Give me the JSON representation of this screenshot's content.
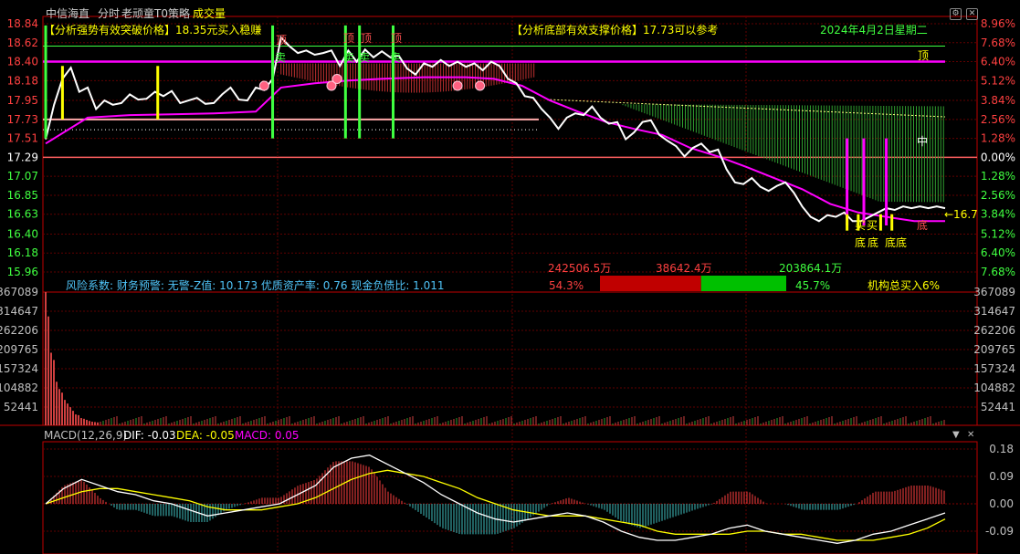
{
  "header": {
    "stock_name": "中信海直",
    "view_mode": "分时",
    "strategy_name": "老顽童T0策略",
    "indicator_name": "成交量",
    "break_price_label": "【分析强势有效突破价格】",
    "break_price_text": "18.35元买入稳赚",
    "support_price_label": "【分析底部有效支撑价格】",
    "support_price_text": "17.73可以参考",
    "date_text": "2024年4月2日星期二"
  },
  "colors": {
    "background": "#000000",
    "frame": "#c00000",
    "price_up": "#ff4040",
    "price_down": "#40ff40",
    "flat": "#ffffff",
    "price_line": "#ffffff",
    "avg_line": "#ff00ff",
    "band_line": "#cc00cc",
    "pink_line": "#ffaaaa",
    "volume_bar": "#d04040",
    "dif": "#ffffff",
    "dea": "#ffff00",
    "macd_label": "#ff00ff"
  },
  "price_axis": {
    "left": [
      "18.84",
      "18.62",
      "18.40",
      "18.18",
      "17.95",
      "17.73",
      "17.51",
      "17.29",
      "17.07",
      "16.85",
      "16.63",
      "16.40",
      "16.18",
      "15.96"
    ],
    "right": [
      "8.96%",
      "7.68%",
      "6.40%",
      "5.12%",
      "3.84%",
      "2.56%",
      "1.28%",
      "0.00%",
      "1.28%",
      "2.56%",
      "3.84%",
      "5.12%",
      "6.40%",
      "7.68%"
    ]
  },
  "volume_axis": {
    "left": [
      "367089",
      "314647",
      "262206",
      "209765",
      "157324",
      "104882",
      "52441"
    ],
    "right": [
      "367089",
      "314647",
      "262206",
      "209765",
      "157324",
      "104882",
      "52441"
    ]
  },
  "macd_axis": [
    "0.18",
    "0.09",
    "0.00",
    "-0.09"
  ],
  "signals": {
    "top": "顶",
    "sell": "卖",
    "buy": "买",
    "bottom": "底",
    "middle": "中",
    "current_price_tag": "←16.7"
  },
  "fund_flow": {
    "buy_amount": "242506.5万",
    "net_amount": "38642.4万",
    "sell_amount": "203864.1万",
    "buy_pct": "54.3%",
    "sell_pct": "45.7%",
    "institution_text": "机构总买入6%",
    "buy_ratio": 0.543
  },
  "fundamentals": {
    "text": "风险系数: 财务预警: 无警-Z值: 10.173 优质资产率: 0.76 现金负债比: 1.011"
  },
  "macd": {
    "title": "MACD(12,26,9)",
    "dif": "DIF: -0.03",
    "dea": "DEA: -0.05",
    "macd": "MACD: 0.05"
  },
  "chart_data": {
    "type": "line",
    "title": "中信海直 分时",
    "reference_price": 17.29,
    "price_range": [
      15.96,
      18.84
    ],
    "break_price": 18.35,
    "support_price": 17.73,
    "upper_limit_line": 18.4,
    "prev_band_line": 17.8,
    "price_points": [
      [
        0,
        17.5
      ],
      [
        3,
        17.9
      ],
      [
        6,
        18.2
      ],
      [
        9,
        18.33
      ],
      [
        12,
        18.05
      ],
      [
        15,
        18.1
      ],
      [
        18,
        17.85
      ],
      [
        21,
        17.95
      ],
      [
        24,
        17.9
      ],
      [
        27,
        17.92
      ],
      [
        30,
        18.02
      ],
      [
        33,
        17.96
      ],
      [
        36,
        17.97
      ],
      [
        39,
        18.05
      ],
      [
        42,
        18.0
      ],
      [
        45,
        18.06
      ],
      [
        48,
        17.92
      ],
      [
        51,
        17.95
      ],
      [
        54,
        17.98
      ],
      [
        57,
        17.91
      ],
      [
        60,
        17.92
      ],
      [
        63,
        18.02
      ],
      [
        66,
        18.1
      ],
      [
        69,
        17.96
      ],
      [
        72,
        17.95
      ],
      [
        75,
        18.1
      ],
      [
        78,
        18.07
      ],
      [
        81,
        18.2
      ],
      [
        84,
        18.68
      ],
      [
        87,
        18.58
      ],
      [
        90,
        18.5
      ],
      [
        93,
        18.53
      ],
      [
        96,
        18.48
      ],
      [
        99,
        18.5
      ],
      [
        102,
        18.53
      ],
      [
        105,
        18.35
      ],
      [
        108,
        18.53
      ],
      [
        111,
        18.4
      ],
      [
        114,
        18.54
      ],
      [
        117,
        18.45
      ],
      [
        120,
        18.52
      ],
      [
        123,
        18.45
      ],
      [
        126,
        18.47
      ],
      [
        129,
        18.32
      ],
      [
        132,
        18.25
      ],
      [
        135,
        18.38
      ],
      [
        138,
        18.34
      ],
      [
        141,
        18.42
      ],
      [
        144,
        18.35
      ],
      [
        147,
        18.4
      ],
      [
        150,
        18.34
      ],
      [
        153,
        18.38
      ],
      [
        156,
        18.3
      ],
      [
        159,
        18.4
      ],
      [
        162,
        18.35
      ],
      [
        165,
        18.2
      ],
      [
        168,
        18.15
      ],
      [
        171,
        18.0
      ],
      [
        174,
        17.98
      ],
      [
        177,
        17.85
      ],
      [
        180,
        17.75
      ],
      [
        183,
        17.62
      ],
      [
        186,
        17.75
      ],
      [
        189,
        17.8
      ],
      [
        192,
        17.78
      ],
      [
        195,
        17.88
      ],
      [
        198,
        17.75
      ],
      [
        201,
        17.68
      ],
      [
        204,
        17.7
      ],
      [
        207,
        17.5
      ],
      [
        210,
        17.58
      ],
      [
        213,
        17.7
      ],
      [
        216,
        17.72
      ],
      [
        219,
        17.55
      ],
      [
        222,
        17.48
      ],
      [
        225,
        17.42
      ],
      [
        228,
        17.3
      ],
      [
        231,
        17.4
      ],
      [
        234,
        17.45
      ],
      [
        237,
        17.35
      ],
      [
        240,
        17.38
      ],
      [
        243,
        17.15
      ],
      [
        246,
        17.0
      ],
      [
        249,
        16.98
      ],
      [
        252,
        17.05
      ],
      [
        255,
        16.95
      ],
      [
        258,
        16.9
      ],
      [
        261,
        16.96
      ],
      [
        264,
        17.0
      ],
      [
        267,
        16.88
      ],
      [
        270,
        16.72
      ],
      [
        273,
        16.6
      ],
      [
        276,
        16.55
      ],
      [
        279,
        16.62
      ],
      [
        282,
        16.6
      ],
      [
        285,
        16.65
      ],
      [
        288,
        16.55
      ],
      [
        291,
        16.55
      ],
      [
        294,
        16.6
      ],
      [
        297,
        16.65
      ],
      [
        300,
        16.7
      ],
      [
        303,
        16.68
      ],
      [
        306,
        16.72
      ],
      [
        309,
        16.7
      ],
      [
        312,
        16.72
      ],
      [
        315,
        16.7
      ],
      [
        318,
        16.72
      ],
      [
        321,
        16.7
      ]
    ],
    "avg_points": [
      [
        0,
        17.45
      ],
      [
        15,
        17.75
      ],
      [
        30,
        17.78
      ],
      [
        45,
        17.79
      ],
      [
        60,
        17.8
      ],
      [
        75,
        17.82
      ],
      [
        84,
        18.1
      ],
      [
        96,
        18.15
      ],
      [
        108,
        18.18
      ],
      [
        120,
        18.2
      ],
      [
        135,
        18.22
      ],
      [
        150,
        18.22
      ],
      [
        160,
        18.2
      ],
      [
        170,
        18.12
      ],
      [
        180,
        17.95
      ],
      [
        190,
        17.82
      ],
      [
        200,
        17.7
      ],
      [
        210,
        17.62
      ],
      [
        220,
        17.55
      ],
      [
        230,
        17.4
      ],
      [
        240,
        17.3
      ],
      [
        250,
        17.18
      ],
      [
        260,
        17.05
      ],
      [
        270,
        16.92
      ],
      [
        280,
        16.75
      ],
      [
        290,
        16.65
      ],
      [
        300,
        16.6
      ],
      [
        310,
        16.55
      ],
      [
        321,
        16.55
      ]
    ],
    "volume_points": [
      367089,
      300000,
      200000,
      180000,
      120000,
      100000,
      90000,
      70000,
      60000,
      50000,
      40000,
      30000,
      28000,
      20000,
      18000,
      15000,
      12000,
      10000,
      9000,
      8000
    ],
    "macd_dif": [
      0.0,
      0.05,
      0.08,
      0.06,
      0.04,
      0.03,
      0.01,
      0.0,
      -0.02,
      -0.04,
      -0.03,
      -0.02,
      -0.01,
      0.0,
      0.03,
      0.06,
      0.12,
      0.15,
      0.16,
      0.13,
      0.1,
      0.07,
      0.03,
      0.0,
      -0.03,
      -0.05,
      -0.06,
      -0.05,
      -0.04,
      -0.03,
      -0.04,
      -0.06,
      -0.09,
      -0.11,
      -0.12,
      -0.12,
      -0.11,
      -0.1,
      -0.08,
      -0.07,
      -0.09,
      -0.1,
      -0.11,
      -0.12,
      -0.13,
      -0.12,
      -0.1,
      -0.09,
      -0.07,
      -0.05,
      -0.03
    ],
    "macd_dea": [
      0.0,
      0.02,
      0.04,
      0.05,
      0.05,
      0.04,
      0.03,
      0.02,
      0.01,
      -0.01,
      -0.02,
      -0.02,
      -0.02,
      -0.01,
      0.0,
      0.02,
      0.05,
      0.08,
      0.1,
      0.11,
      0.1,
      0.09,
      0.07,
      0.05,
      0.02,
      0.0,
      -0.02,
      -0.03,
      -0.04,
      -0.04,
      -0.04,
      -0.05,
      -0.06,
      -0.07,
      -0.09,
      -0.1,
      -0.1,
      -0.1,
      -0.1,
      -0.09,
      -0.09,
      -0.1,
      -0.1,
      -0.11,
      -0.12,
      -0.12,
      -0.12,
      -0.11,
      -0.1,
      -0.08,
      -0.05
    ]
  }
}
